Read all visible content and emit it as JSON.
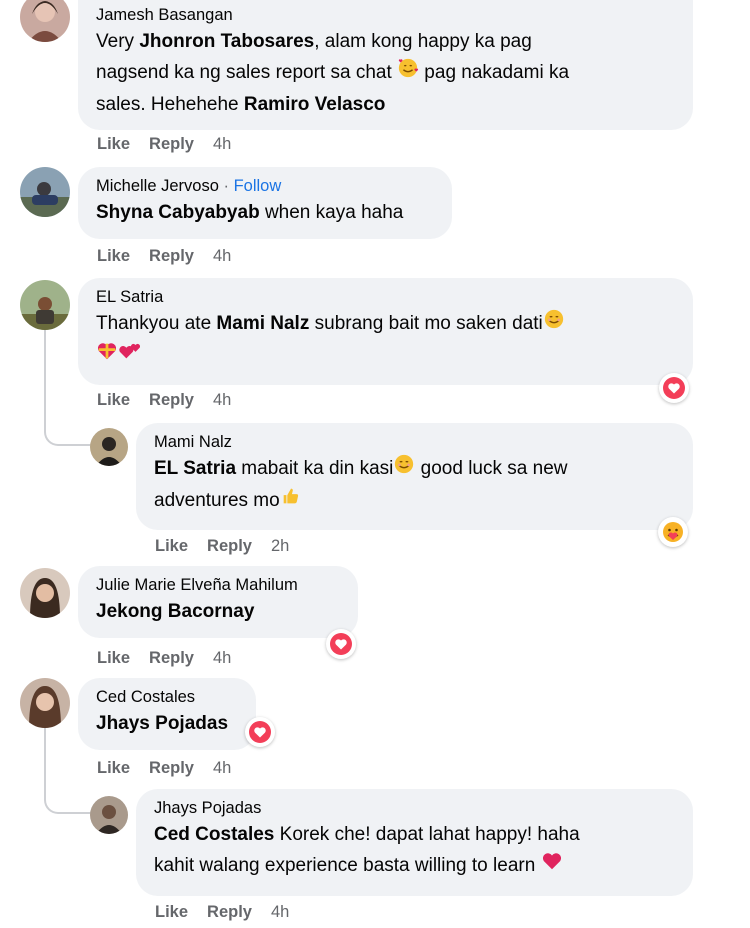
{
  "actions": {
    "like": "Like",
    "reply": "Reply"
  },
  "comments": [
    {
      "author": "Jamesh Basangan",
      "lines": [
        {
          "parts": [
            {
              "text": "Very ",
              "b": false
            },
            {
              "text": "Jhonron Tabosares",
              "b": true
            },
            {
              "text": ", alam kong happy ka pag",
              "b": false
            }
          ]
        },
        {
          "parts": [
            {
              "text": "nagsend ka ng sales report sa chat ",
              "b": false
            },
            {
              "emoji": "smiling-face-with-hearts"
            },
            {
              "text": " pag nakadami ka",
              "b": false
            }
          ]
        },
        {
          "parts": [
            {
              "text": "sales. Hehehehe ",
              "b": false
            },
            {
              "text": "Ramiro Velasco",
              "b": true
            }
          ]
        }
      ],
      "time": "4h"
    },
    {
      "author": "Michelle Jervoso",
      "follow": "Follow",
      "lines": [
        {
          "parts": [
            {
              "text": "Shyna Cabyabyab",
              "b": true
            },
            {
              "text": " when kaya haha",
              "b": false
            }
          ]
        }
      ],
      "time": "4h"
    },
    {
      "author": "EL Satria",
      "lines": [
        {
          "parts": [
            {
              "text": "Thankyou ate ",
              "b": false
            },
            {
              "text": "Mami Nalz",
              "b": true
            },
            {
              "text": " subrang bait mo saken dati",
              "b": false
            },
            {
              "emoji": "smiling-face"
            }
          ]
        },
        {
          "parts": [
            {
              "emoji": "heart-with-ribbon"
            },
            {
              "emoji": "two-hearts"
            }
          ]
        }
      ],
      "time": "4h",
      "reaction": "love-reaction-icon"
    },
    {
      "author": "Mami Nalz",
      "lines": [
        {
          "parts": [
            {
              "text": "EL Satria",
              "b": true
            },
            {
              "text": " mabait ka din kasi",
              "b": false
            },
            {
              "emoji": "smiling-face"
            },
            {
              "text": " good luck sa new",
              "b": false
            }
          ]
        },
        {
          "parts": [
            {
              "text": "adventures mo",
              "b": false
            },
            {
              "emoji": "thumbs-up"
            }
          ]
        }
      ],
      "time": "2h",
      "reaction": "care-reaction-icon"
    },
    {
      "author": "Julie Marie Elveña Mahilum",
      "lines": [
        {
          "parts": [
            {
              "text": "Jekong Bacornay",
              "b": true
            }
          ]
        }
      ],
      "time": "4h",
      "reaction": "love-reaction-icon"
    },
    {
      "author": "Ced Costales",
      "lines": [
        {
          "parts": [
            {
              "text": "Jhays Pojadas",
              "b": true
            }
          ]
        }
      ],
      "time": "4h",
      "reaction": "love-reaction-icon"
    },
    {
      "author": "Jhays Pojadas",
      "lines": [
        {
          "parts": [
            {
              "text": "Ced Costales",
              "b": true
            },
            {
              "text": " Korek che! dapat lahat happy! haha",
              "b": false
            }
          ]
        },
        {
          "parts": [
            {
              "text": "kahit walang experience basta willing to learn ",
              "b": false
            },
            {
              "emoji": "red-heart"
            }
          ]
        }
      ],
      "time": "4h"
    }
  ]
}
